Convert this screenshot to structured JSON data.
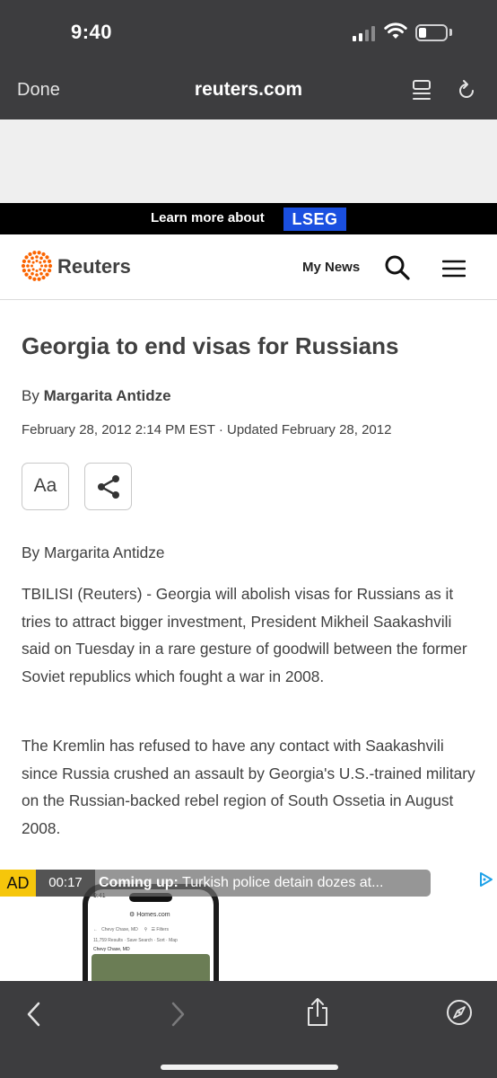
{
  "status_bar": {
    "time": "9:40"
  },
  "browser": {
    "done_label": "Done",
    "url": "reuters.com",
    "reader_icon": "reader-icon",
    "reload_icon": "reload-icon"
  },
  "promo_banner": {
    "text": "Learn more about",
    "badge": "LSEG",
    "badge_color": "#1a4fe0"
  },
  "site_header": {
    "logo_text": "Reuters",
    "logo_color": "#fa6400",
    "my_news_label": "My News"
  },
  "article": {
    "headline": "Georgia to end visas for Russians",
    "byline_prefix": "By",
    "author": "Margarita Antidze",
    "dateline": "February 28, 2012 2:14 PM EST · Updated February 28, 2012",
    "font_button_label": "Aa",
    "body_byline": "By Margarita Antidze",
    "paragraphs": [
      "TBILISI (Reuters) - Georgia will abolish visas for Russians as it tries to attract bigger investment, President Mikheil Saakashvili said on Tuesday in a rare gesture of goodwill between the former Soviet republics which fought a war in 2008.",
      "The Kremlin has refused to have any contact with Saakashvili since Russia crushed an assault by Georgia's U.S.-trained military on the Russian-backed rebel region of South Ossetia in August 2008."
    ]
  },
  "video_ad": {
    "ad_label": "AD",
    "timer": "00:17",
    "coming_up_label": "Coming up:",
    "coming_up_title": " Turkish police detain dozes at...",
    "ad_label_color": "#f6c60b"
  },
  "bottom_toolbar": {
    "icons": [
      "back-icon",
      "forward-icon",
      "share-icon",
      "compass-icon"
    ]
  }
}
